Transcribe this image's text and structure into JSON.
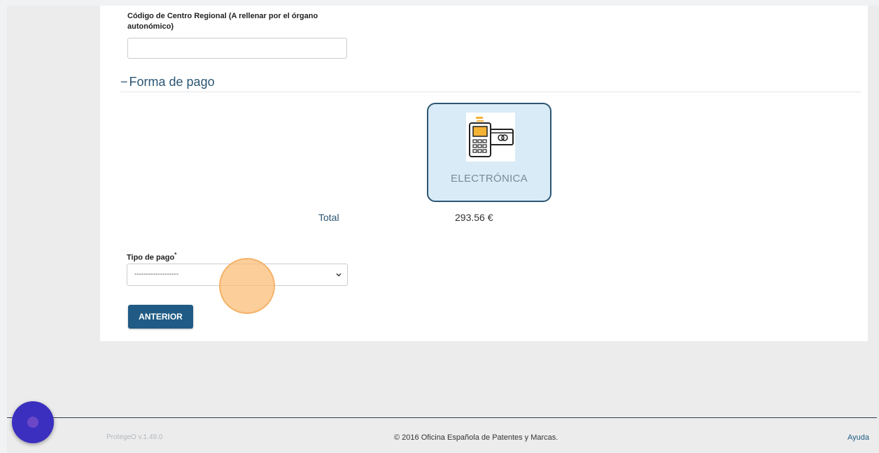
{
  "form": {
    "centro_label_line1": "Código de Centro Regional (A rellenar por el órgano",
    "centro_label_line2": "autonómico)",
    "centro_value": ""
  },
  "payment_section": {
    "toggle": "−",
    "title": "Forma de pago",
    "method_label": "ELECTRÓNICA",
    "method_icon": "card-terminal-icon",
    "total_label": "Total",
    "total_value": "293.56 €"
  },
  "tipo_pago": {
    "label": "Tipo de pago",
    "required_mark": "*",
    "selected": "-------------------"
  },
  "buttons": {
    "anterior": "ANTERIOR"
  },
  "footer": {
    "version": "ProtegeO v.1.49.0",
    "copyright": "© 2016 Oficina Española de Patentes y Marcas.",
    "help": "Ayuda"
  },
  "colors": {
    "accent": "#2b5673",
    "button": "#1f5b85",
    "card_bg": "#d9ebf6",
    "fab": "#3b2fbf"
  }
}
